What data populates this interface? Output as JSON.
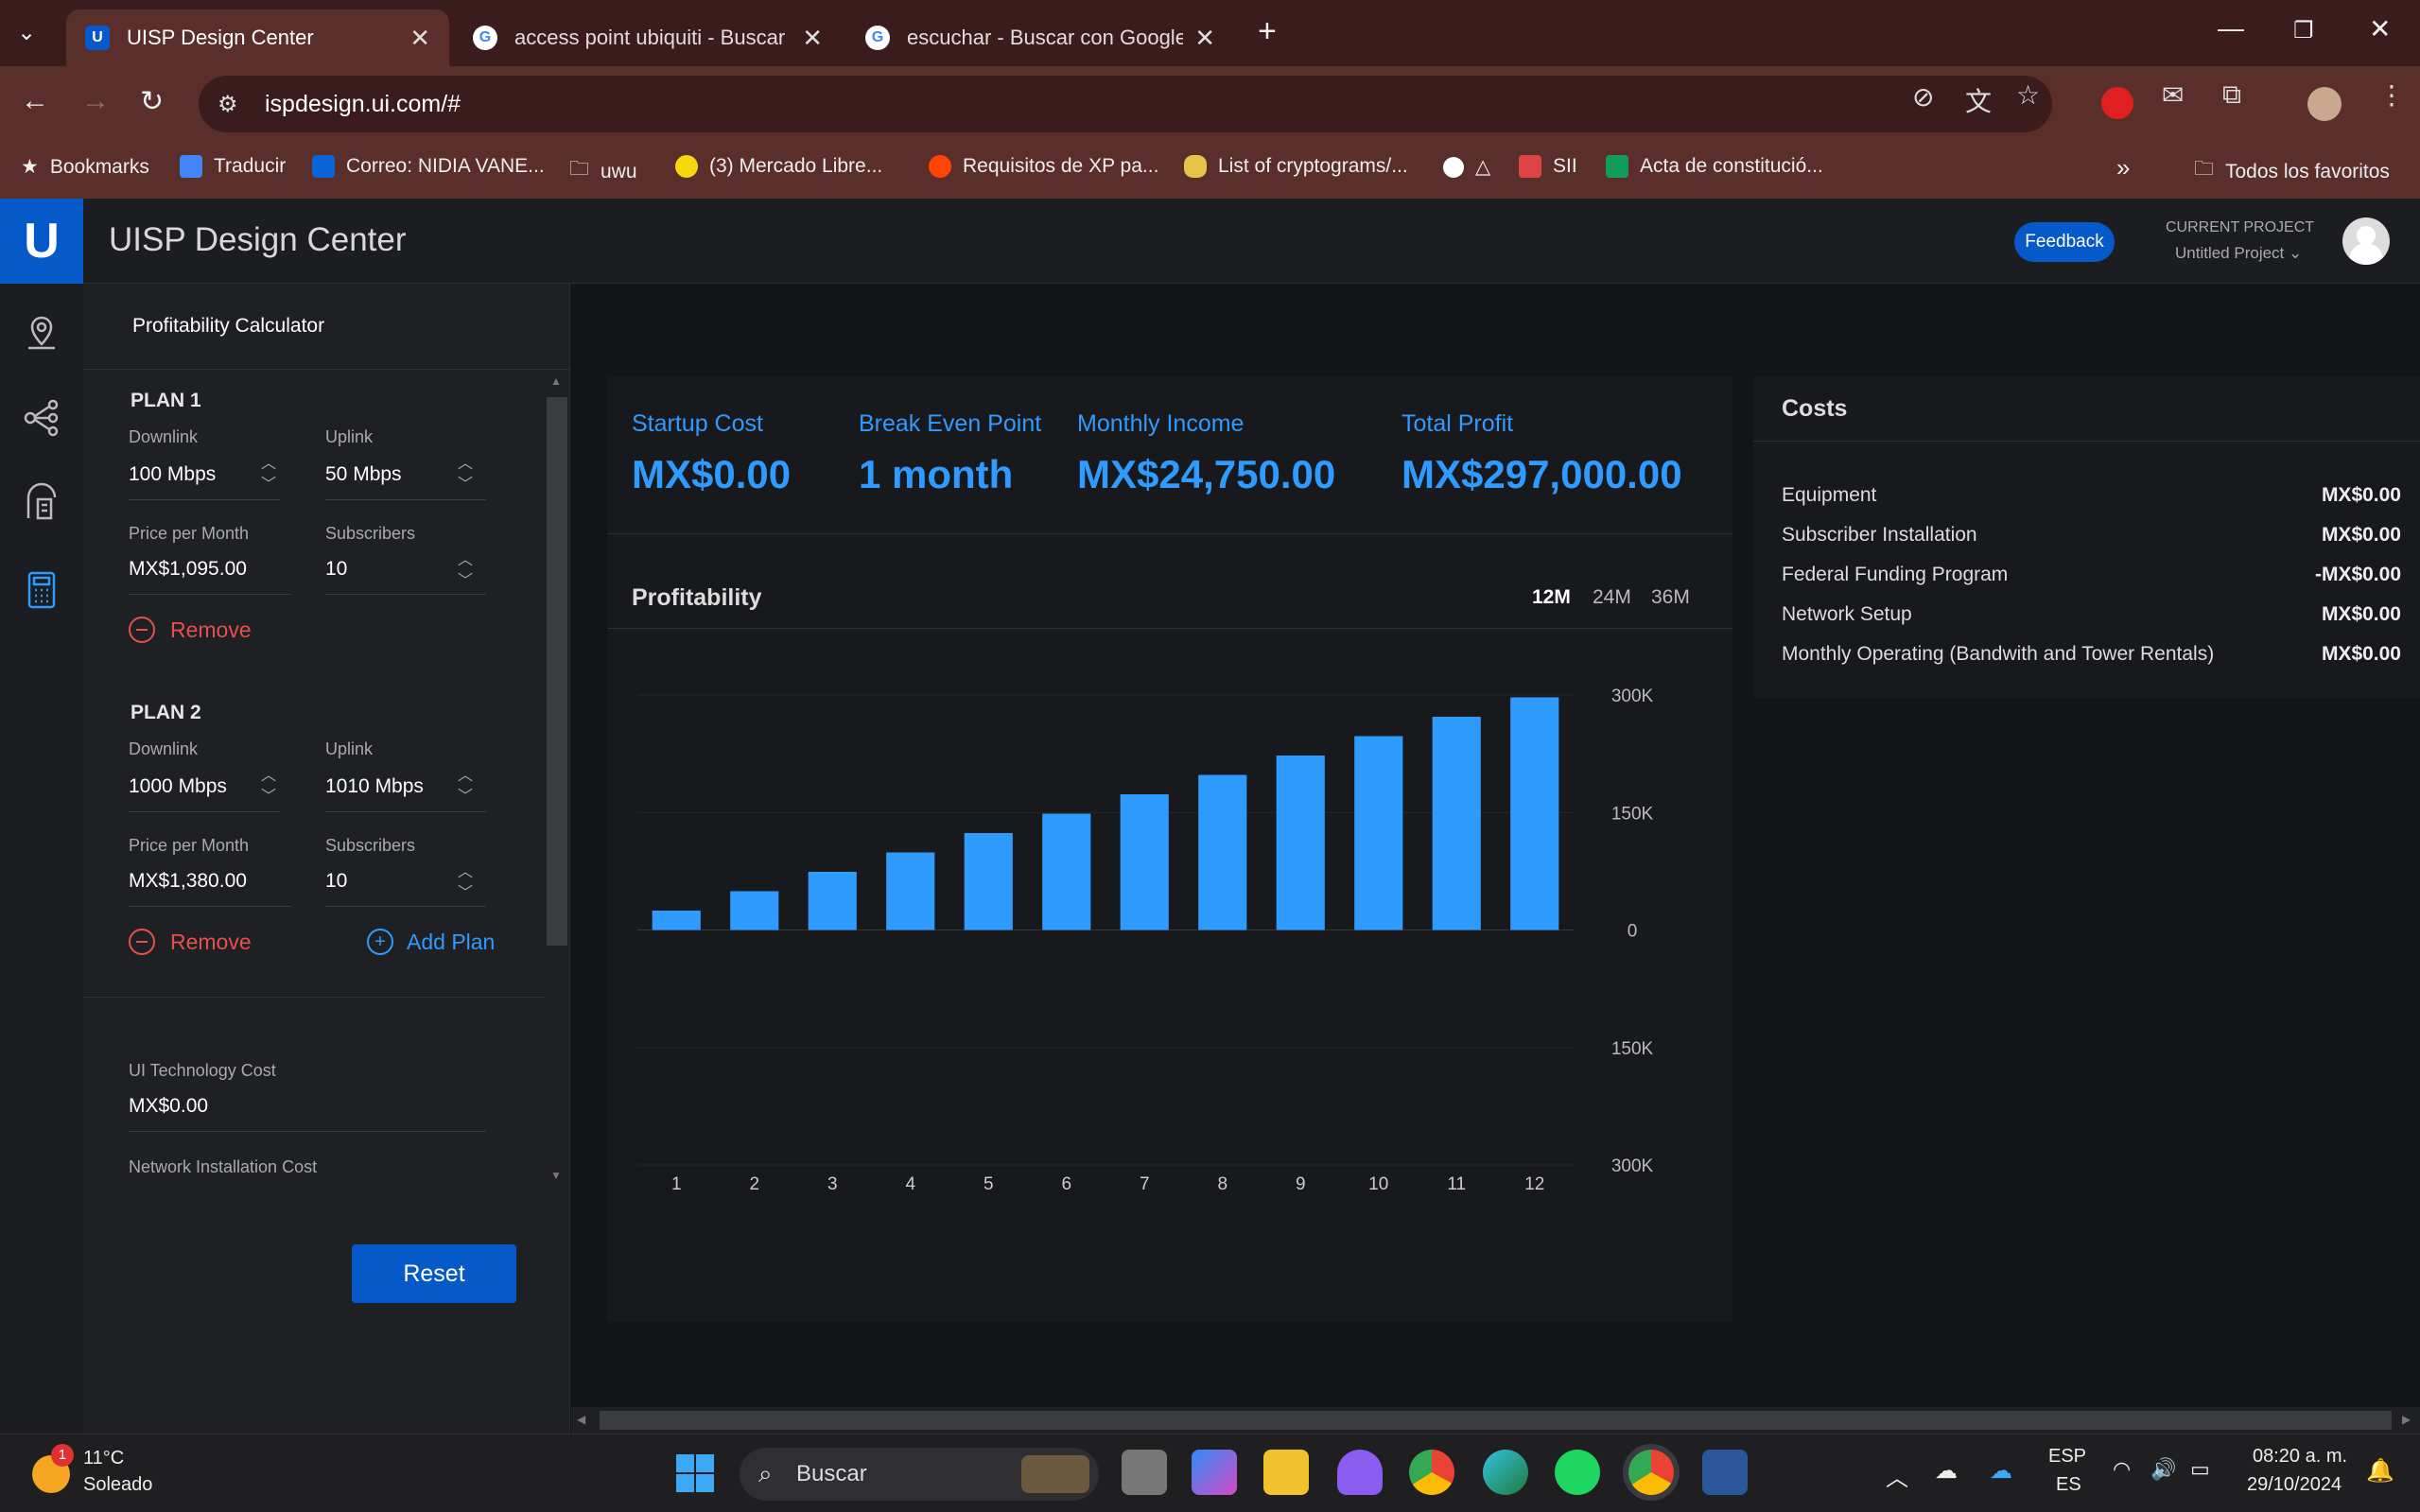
{
  "browser": {
    "tabs": [
      {
        "title": "UISP Design Center",
        "active": true
      },
      {
        "title": "access point ubiquiti - Buscar c",
        "active": false
      },
      {
        "title": "escuchar - Buscar con Google",
        "active": false
      }
    ],
    "url": "ispdesign.ui.com/#",
    "bookmarks": [
      "Bookmarks",
      "Traducir",
      "Correo: NIDIA VANE...",
      "uwu",
      "(3) Mercado Libre...",
      "Requisitos de XP pa...",
      "List of cryptograms/...",
      "△",
      "SII",
      "Acta de constitució..."
    ],
    "all_bookmarks": "Todos los favoritos"
  },
  "app": {
    "logo": "U",
    "title": "UISP Design Center",
    "feedback": "Feedback",
    "project_label": "CURRENT PROJECT",
    "project_name": "Untitled Project"
  },
  "panel": {
    "title": "Profitability Calculator",
    "plans": [
      {
        "heading": "PLAN 1",
        "downlink_label": "Downlink",
        "downlink": "100",
        "downlink_unit": "Mbps",
        "uplink_label": "Uplink",
        "uplink": "50",
        "uplink_unit": "Mbps",
        "price_label": "Price per Month",
        "price": "MX$1,095.00",
        "subs_label": "Subscribers",
        "subs": "10",
        "remove": "Remove"
      },
      {
        "heading": "PLAN 2",
        "downlink_label": "Downlink",
        "downlink": "1000",
        "downlink_unit": "Mbps",
        "uplink_label": "Uplink",
        "uplink": "1010",
        "uplink_unit": "Mbps",
        "price_label": "Price per Month",
        "price": "MX$1,380.00",
        "subs_label": "Subscribers",
        "subs": "10",
        "remove": "Remove"
      }
    ],
    "add_plan": "Add Plan",
    "tech_cost_label": "UI Technology Cost",
    "tech_cost": "MX$0.00",
    "install_cost_label": "Network Installation Cost",
    "reset": "Reset"
  },
  "kpis": {
    "startup_label": "Startup Cost",
    "startup": "MX$0.00",
    "breakeven_label": "Break Even Point",
    "breakeven": "1 month",
    "income_label": "Monthly Income",
    "income": "MX$24,750.00",
    "profit_label": "Total Profit",
    "profit": "MX$297,000.00"
  },
  "profitability": {
    "title": "Profitability",
    "ranges": [
      "12M",
      "24M",
      "36M"
    ],
    "selected_range": "12M"
  },
  "chart_data": {
    "type": "bar",
    "categories": [
      "1",
      "2",
      "3",
      "4",
      "5",
      "6",
      "7",
      "8",
      "9",
      "10",
      "11",
      "12"
    ],
    "values": [
      24750,
      49500,
      74250,
      99000,
      123750,
      148500,
      173250,
      198000,
      222750,
      247500,
      272250,
      297000
    ],
    "ylim": [
      -300000,
      300000
    ],
    "ytick_labels": [
      "300K",
      "150K",
      "0",
      "150K",
      "300K"
    ],
    "ytick_values": [
      300000,
      150000,
      0,
      -150000,
      -300000
    ],
    "grid": true,
    "color": "#2f9bff"
  },
  "costs": {
    "title": "Costs",
    "rows": [
      {
        "label": "Equipment",
        "value": "MX$0.00"
      },
      {
        "label": "Subscriber Installation",
        "value": "MX$0.00"
      },
      {
        "label": "Federal Funding Program",
        "value": "-MX$0.00"
      },
      {
        "label": "Network Setup",
        "value": "MX$0.00"
      },
      {
        "label": "Monthly Operating (Bandwith and Tower Rentals)",
        "value": "MX$0.00"
      }
    ]
  },
  "taskbar": {
    "weather_temp": "11°C",
    "weather_desc": "Soleado",
    "weather_badge": "1",
    "search": "Buscar",
    "lang1": "ESP",
    "lang2": "ES",
    "time": "08:20 a. m.",
    "date": "29/10/2024"
  }
}
